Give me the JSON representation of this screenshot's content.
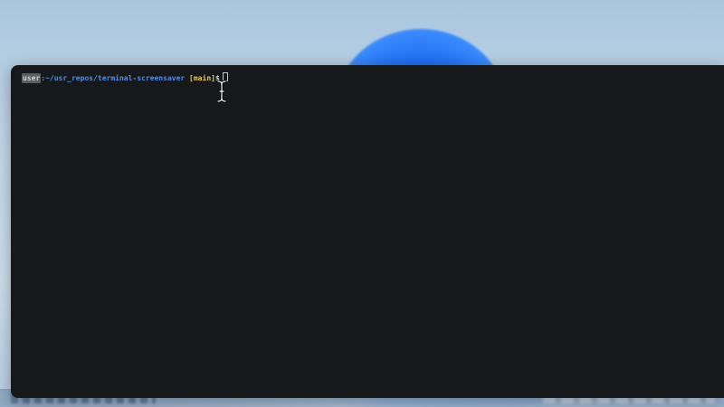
{
  "terminal": {
    "prompt": {
      "user": "user",
      "cwd": ":~/usr_repos/terminal-screensaver",
      "branch": "[main]",
      "symbol": "$"
    }
  },
  "icons": {
    "cursor": "ibeam-cursor-icon",
    "caret": "block-caret-icon"
  },
  "colors": {
    "terminal_bg": "#17181a",
    "cwd": "#4f8fe8",
    "branch": "#e6c94c",
    "desktop_top": "#a9c6de",
    "wallpaper_bloom": "#1e6cf2"
  }
}
